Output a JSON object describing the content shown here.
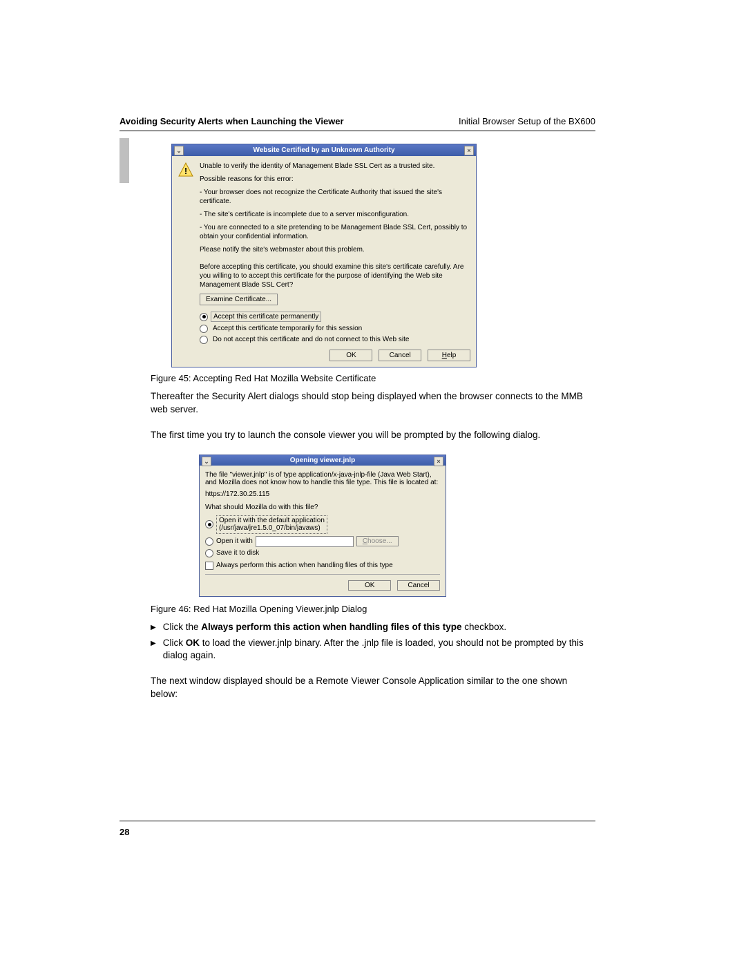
{
  "header": {
    "left": "Avoiding Security Alerts when Launching the Viewer",
    "right": "Initial Browser Setup of the BX600"
  },
  "dialog1": {
    "title": "Website Certified by an Unknown Authority",
    "line1": "Unable to verify the identity of Management Blade SSL Cert as a trusted site.",
    "line2": "Possible reasons for this error:",
    "reason1": "- Your browser does not recognize the Certificate Authority that issued the site's certificate.",
    "reason2": "- The site's certificate is incomplete due to a server misconfiguration.",
    "reason3": "- You are connected to a site pretending to be Management Blade SSL Cert, possibly to obtain your confidential information.",
    "line3": "Please notify the site's webmaster about this problem.",
    "line4": "Before accepting this certificate, you should examine this site's certificate carefully. Are you willing to to accept this certificate for the purpose of identifying the Web site Management Blade SSL Cert?",
    "examine_btn": "Examine Certificate...",
    "radio1": "Accept this certificate permanently",
    "radio2": "Accept this certificate temporarily for this session",
    "radio3": "Do not accept this certificate and do not connect to this Web site",
    "ok": "OK",
    "cancel": "Cancel",
    "help": "Help",
    "help_u": "H"
  },
  "fig45": "Figure 45: Accepting Red Hat Mozilla Website Certificate",
  "para1": "Thereafter the Security Alert dialogs should stop being displayed when the browser connects to the MMB web server.",
  "para2": "The first time you try to launch the console viewer you will be prompted by the following dialog.",
  "dialog2": {
    "title": "Opening viewer.jnlp",
    "line1": "The file \"viewer.jnlp\" is of type application/x-java-jnlp-file (Java Web Start), and Mozilla does not know how to handle this file type. This file is located at:",
    "url": "https://172.30.25.115",
    "line2": "What should Mozilla do with this file?",
    "radio1a": "Open it with the default application",
    "radio1b": "(/usr/java/jre1.5.0_07/bin/javaws)",
    "radio2": "Open it with",
    "choose": "Choose...",
    "choose_u": "C",
    "radio3": "Save it to disk",
    "check": "Always perform this action when handling files of this type",
    "ok": "OK",
    "cancel": "Cancel"
  },
  "fig46": "Figure 46: Red Hat Mozilla Opening Viewer.jnlp Dialog",
  "bullets": {
    "b1_pre": "Click the ",
    "b1_bold": "Always perform this action when handling files of this type",
    "b1_post": " checkbox.",
    "b2_pre": "Click ",
    "b2_bold": "OK",
    "b2_post": " to load the viewer.jnlp binary. After the .jnlp file is loaded, you should not be prompted by this dialog again."
  },
  "para3": "The next window displayed should be a Remote Viewer Console Application similar to the one shown below:",
  "page_number": "28"
}
